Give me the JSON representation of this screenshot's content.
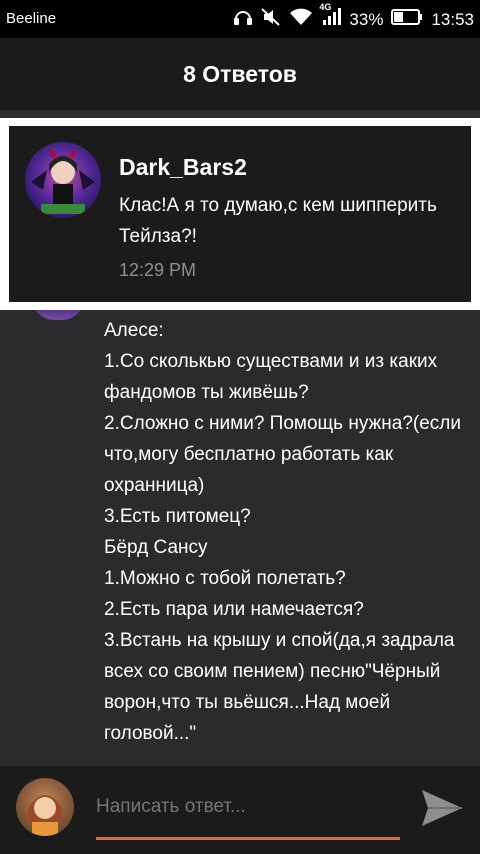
{
  "status_bar": {
    "carrier": "Beeline",
    "network": "4G",
    "battery": "33%",
    "time": "13:53"
  },
  "header": {
    "title": "8 Ответов"
  },
  "highlighted_reply": {
    "username": "Dark_Bars2",
    "message": "Клас!А я то думаю,с кем шипперить Тейлза?!",
    "time": "12:29 PM"
  },
  "thread_message": {
    "text": "Алесе:\n1.Со сколькью существами и из каких фандомов ты живёшь?\n2.Сложно с ними? Помощь нужна?(если что,могу бесплатно работать как охранница)\n3.Есть питомец?\nБёрд Сансу\n1.Можно с тобой полетать?\n2.Есть пара или намечается?\n3.Встань на крышу и спой(да,я задрала всех со своим пением) песню\"Чёрный ворон,что ты вьёшся...Над моей головой...\""
  },
  "composer": {
    "placeholder": "Написать ответ..."
  },
  "colors": {
    "accent": "#e8633a",
    "card_bg": "#1b1b1c",
    "page_bg": "#2b2b2d"
  }
}
